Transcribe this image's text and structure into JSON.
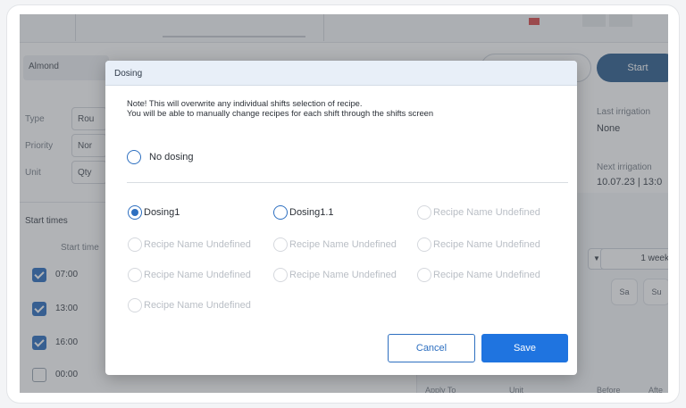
{
  "background": {
    "start_button": "Start",
    "crop_field": "Almond",
    "fields": {
      "type_label": "Type",
      "type_value": "Rou",
      "priority_label": "Priority",
      "priority_value": "Nor",
      "unit_label": "Unit",
      "unit_value": "Qty"
    },
    "last_irrigation_label": "Last irrigation",
    "last_irrigation_value": "None",
    "next_irrigation_label": "Next irrigation",
    "next_irrigation_value": "10.07.23 | 13:0",
    "start_times_label": "Start times",
    "start_time_column": "Start time",
    "times": [
      {
        "time": "07:00",
        "checked": true
      },
      {
        "time": "13:00",
        "checked": true
      },
      {
        "time": "16:00",
        "checked": true
      },
      {
        "time": "00:00",
        "checked": false
      }
    ],
    "repeat_select": "1 week",
    "days": [
      "Sa",
      "Su"
    ],
    "table_headers": [
      "Apply To",
      "Unit",
      "Before",
      "Afte"
    ],
    "colors": {
      "primary": "#2d6fc0",
      "start_button": "#2f5f8f",
      "save_button": "#1f74e0"
    }
  },
  "dialog": {
    "title": "Dosing",
    "note_line1": "Note! This will overwrite any individual shifts selection of recipe.",
    "note_line2": "You will be able to manually change recipes for each shift through the shifts screen",
    "no_dosing_label": "No dosing",
    "recipes": [
      {
        "label": "Dosing1",
        "checked": true,
        "disabled": false
      },
      {
        "label": "Dosing1.1",
        "checked": false,
        "disabled": false
      },
      {
        "label": "Recipe Name Undefined",
        "checked": false,
        "disabled": true
      },
      {
        "label": "Recipe Name Undefined",
        "checked": false,
        "disabled": true
      },
      {
        "label": "Recipe Name Undefined",
        "checked": false,
        "disabled": true
      },
      {
        "label": "Recipe Name Undefined",
        "checked": false,
        "disabled": true
      },
      {
        "label": "Recipe Name Undefined",
        "checked": false,
        "disabled": true
      },
      {
        "label": "Recipe Name Undefined",
        "checked": false,
        "disabled": true
      },
      {
        "label": "Recipe Name Undefined",
        "checked": false,
        "disabled": true
      },
      {
        "label": "Recipe Name Undefined",
        "checked": false,
        "disabled": true
      }
    ],
    "cancel_label": "Cancel",
    "save_label": "Save"
  }
}
